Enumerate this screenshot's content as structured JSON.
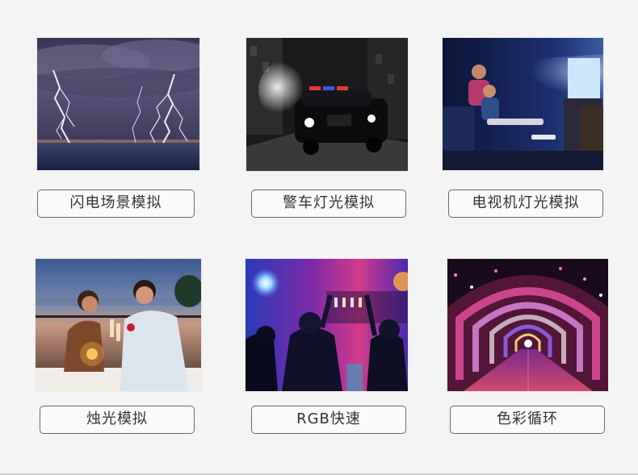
{
  "items": [
    {
      "label": "闪电场景模拟",
      "icon": "lightning-image"
    },
    {
      "label": "警车灯光模拟",
      "icon": "police-car-image"
    },
    {
      "label": "电视机灯光模拟",
      "icon": "tv-light-image"
    },
    {
      "label": "烛光模拟",
      "icon": "candlelight-image"
    },
    {
      "label": "RGB快速",
      "icon": "rgb-party-image"
    },
    {
      "label": "色彩循环",
      "icon": "light-tunnel-image"
    }
  ],
  "colors": {
    "background": "#f4f4f4",
    "label_border": "#6a6a6a",
    "label_text": "#333333"
  }
}
